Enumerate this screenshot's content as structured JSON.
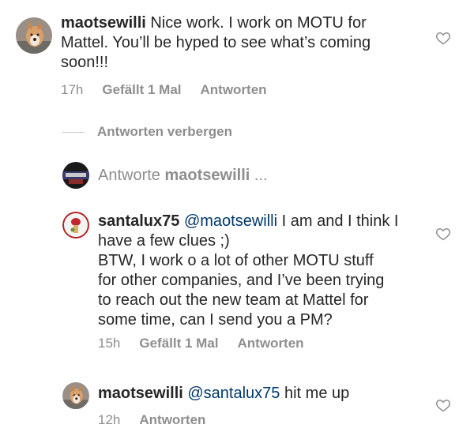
{
  "comments": [
    {
      "username": "maotsewilli",
      "mention": "",
      "text_line1": "Nice work. I work on MOTU for",
      "text_line2": "Mattel. You’ll be hyped to see what’s coming",
      "text_line3": "soon!!!",
      "time": "17h",
      "likes": "Gefällt 1 Mal",
      "reply_label": "Antworten"
    },
    {
      "username": "santalux75",
      "mention": "@maotsewilli",
      "text_line1": "I am and I think I",
      "text_line2": "have a few clues ;)",
      "text_line3": "BTW, I work o a lot of other MOTU stuff",
      "text_line4": "for other companies, and I’ve been trying",
      "text_line5": "to reach out the new team at Mattel for",
      "text_line6": "some time, can I send you a PM?",
      "time": "15h",
      "likes": "Gefällt 1 Mal",
      "reply_label": "Antworten"
    },
    {
      "username": "maotsewilli",
      "mention": "@santalux75",
      "text_line1": "hit me up",
      "time": "12h",
      "reply_label": "Antworten"
    }
  ],
  "hide_replies_label": "Antworten verbergen",
  "reply_box": {
    "prefix": "Antworte",
    "username": "maotsewilli",
    "suffix": "..."
  },
  "colors": {
    "text": "#262626",
    "muted": "#8e8e8e",
    "mention": "#00376b"
  },
  "icons": {
    "like": "heart-outline-icon"
  }
}
